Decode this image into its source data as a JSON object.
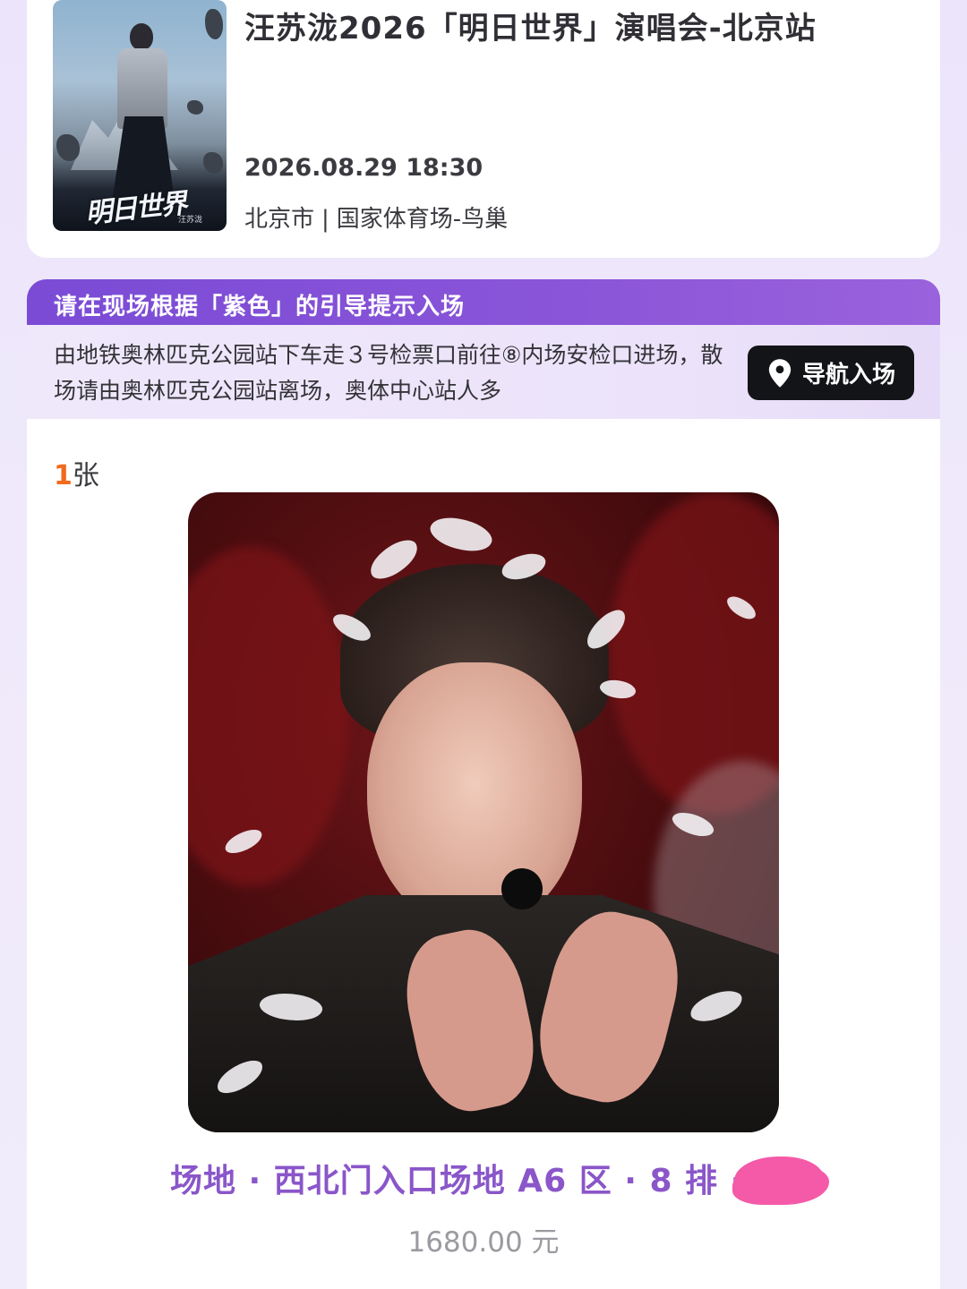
{
  "event": {
    "title": "汪苏泷2026「明日世界」演唱会-北京站",
    "datetime": "2026.08.29 18:30",
    "city": "北京市",
    "separator": "|",
    "venue": "国家体育场-鸟巢",
    "poster_title": "明日世界",
    "poster_artist": "汪苏泷"
  },
  "guide": {
    "header": "请在现场根据「紫色」的引导提示入场",
    "text": "由地铁奥林匹克公园站下车走３号检票口前往⑧内场安检口进场，散场请由奥林匹克公园站离场，奥体中心站人多",
    "nav_button": "导航入场",
    "accent_color": "#7b4bd6"
  },
  "ticket": {
    "count_num": "1",
    "count_unit": "张",
    "seat_info": "场地 · 西北门入口场地 A6 区 · 8 排 ·",
    "price": "1680.00 元",
    "count_color": "#f26a1b",
    "seat_color": "#8a56c9"
  }
}
